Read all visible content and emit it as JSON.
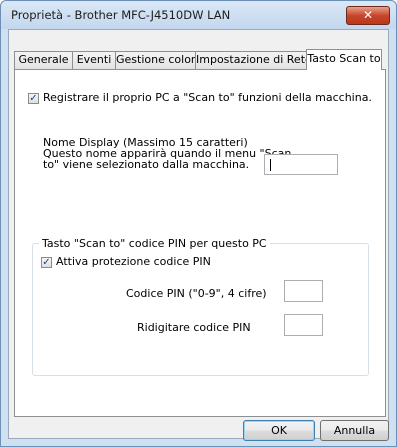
{
  "window": {
    "title": "Proprietà - Brother MFC-J4510DW LAN",
    "close_glyph": "✕"
  },
  "tabs": [
    {
      "label": "Generale",
      "active": false
    },
    {
      "label": "Eventi",
      "active": false
    },
    {
      "label": "Gestione colori",
      "active": false
    },
    {
      "label": "Impostazione di Rete",
      "active": false
    },
    {
      "label": "Tasto Scan to",
      "active": true
    }
  ],
  "register": {
    "checked": true,
    "check_glyph": "✓",
    "label": "Registrare il proprio PC a \"Scan to\" funzioni della macchina."
  },
  "display_name": {
    "line1": "Nome Display (Massimo 15 caratteri)",
    "line2": "Questo nome apparirà quando il menu \"Scan",
    "line3": "to\" viene selezionato dalla macchina.",
    "value": ""
  },
  "pin_group": {
    "title": "Tasto \"Scan to\" codice PIN per questo PC",
    "enable_checked": true,
    "enable_label": "Attiva protezione codice PIN",
    "pin_label": "Codice PIN (\"0-9\", 4 cifre)",
    "pin_value": "",
    "retype_label": "Ridigitare codice PIN",
    "retype_value": ""
  },
  "buttons": {
    "ok": "OK",
    "cancel": "Annulla"
  }
}
